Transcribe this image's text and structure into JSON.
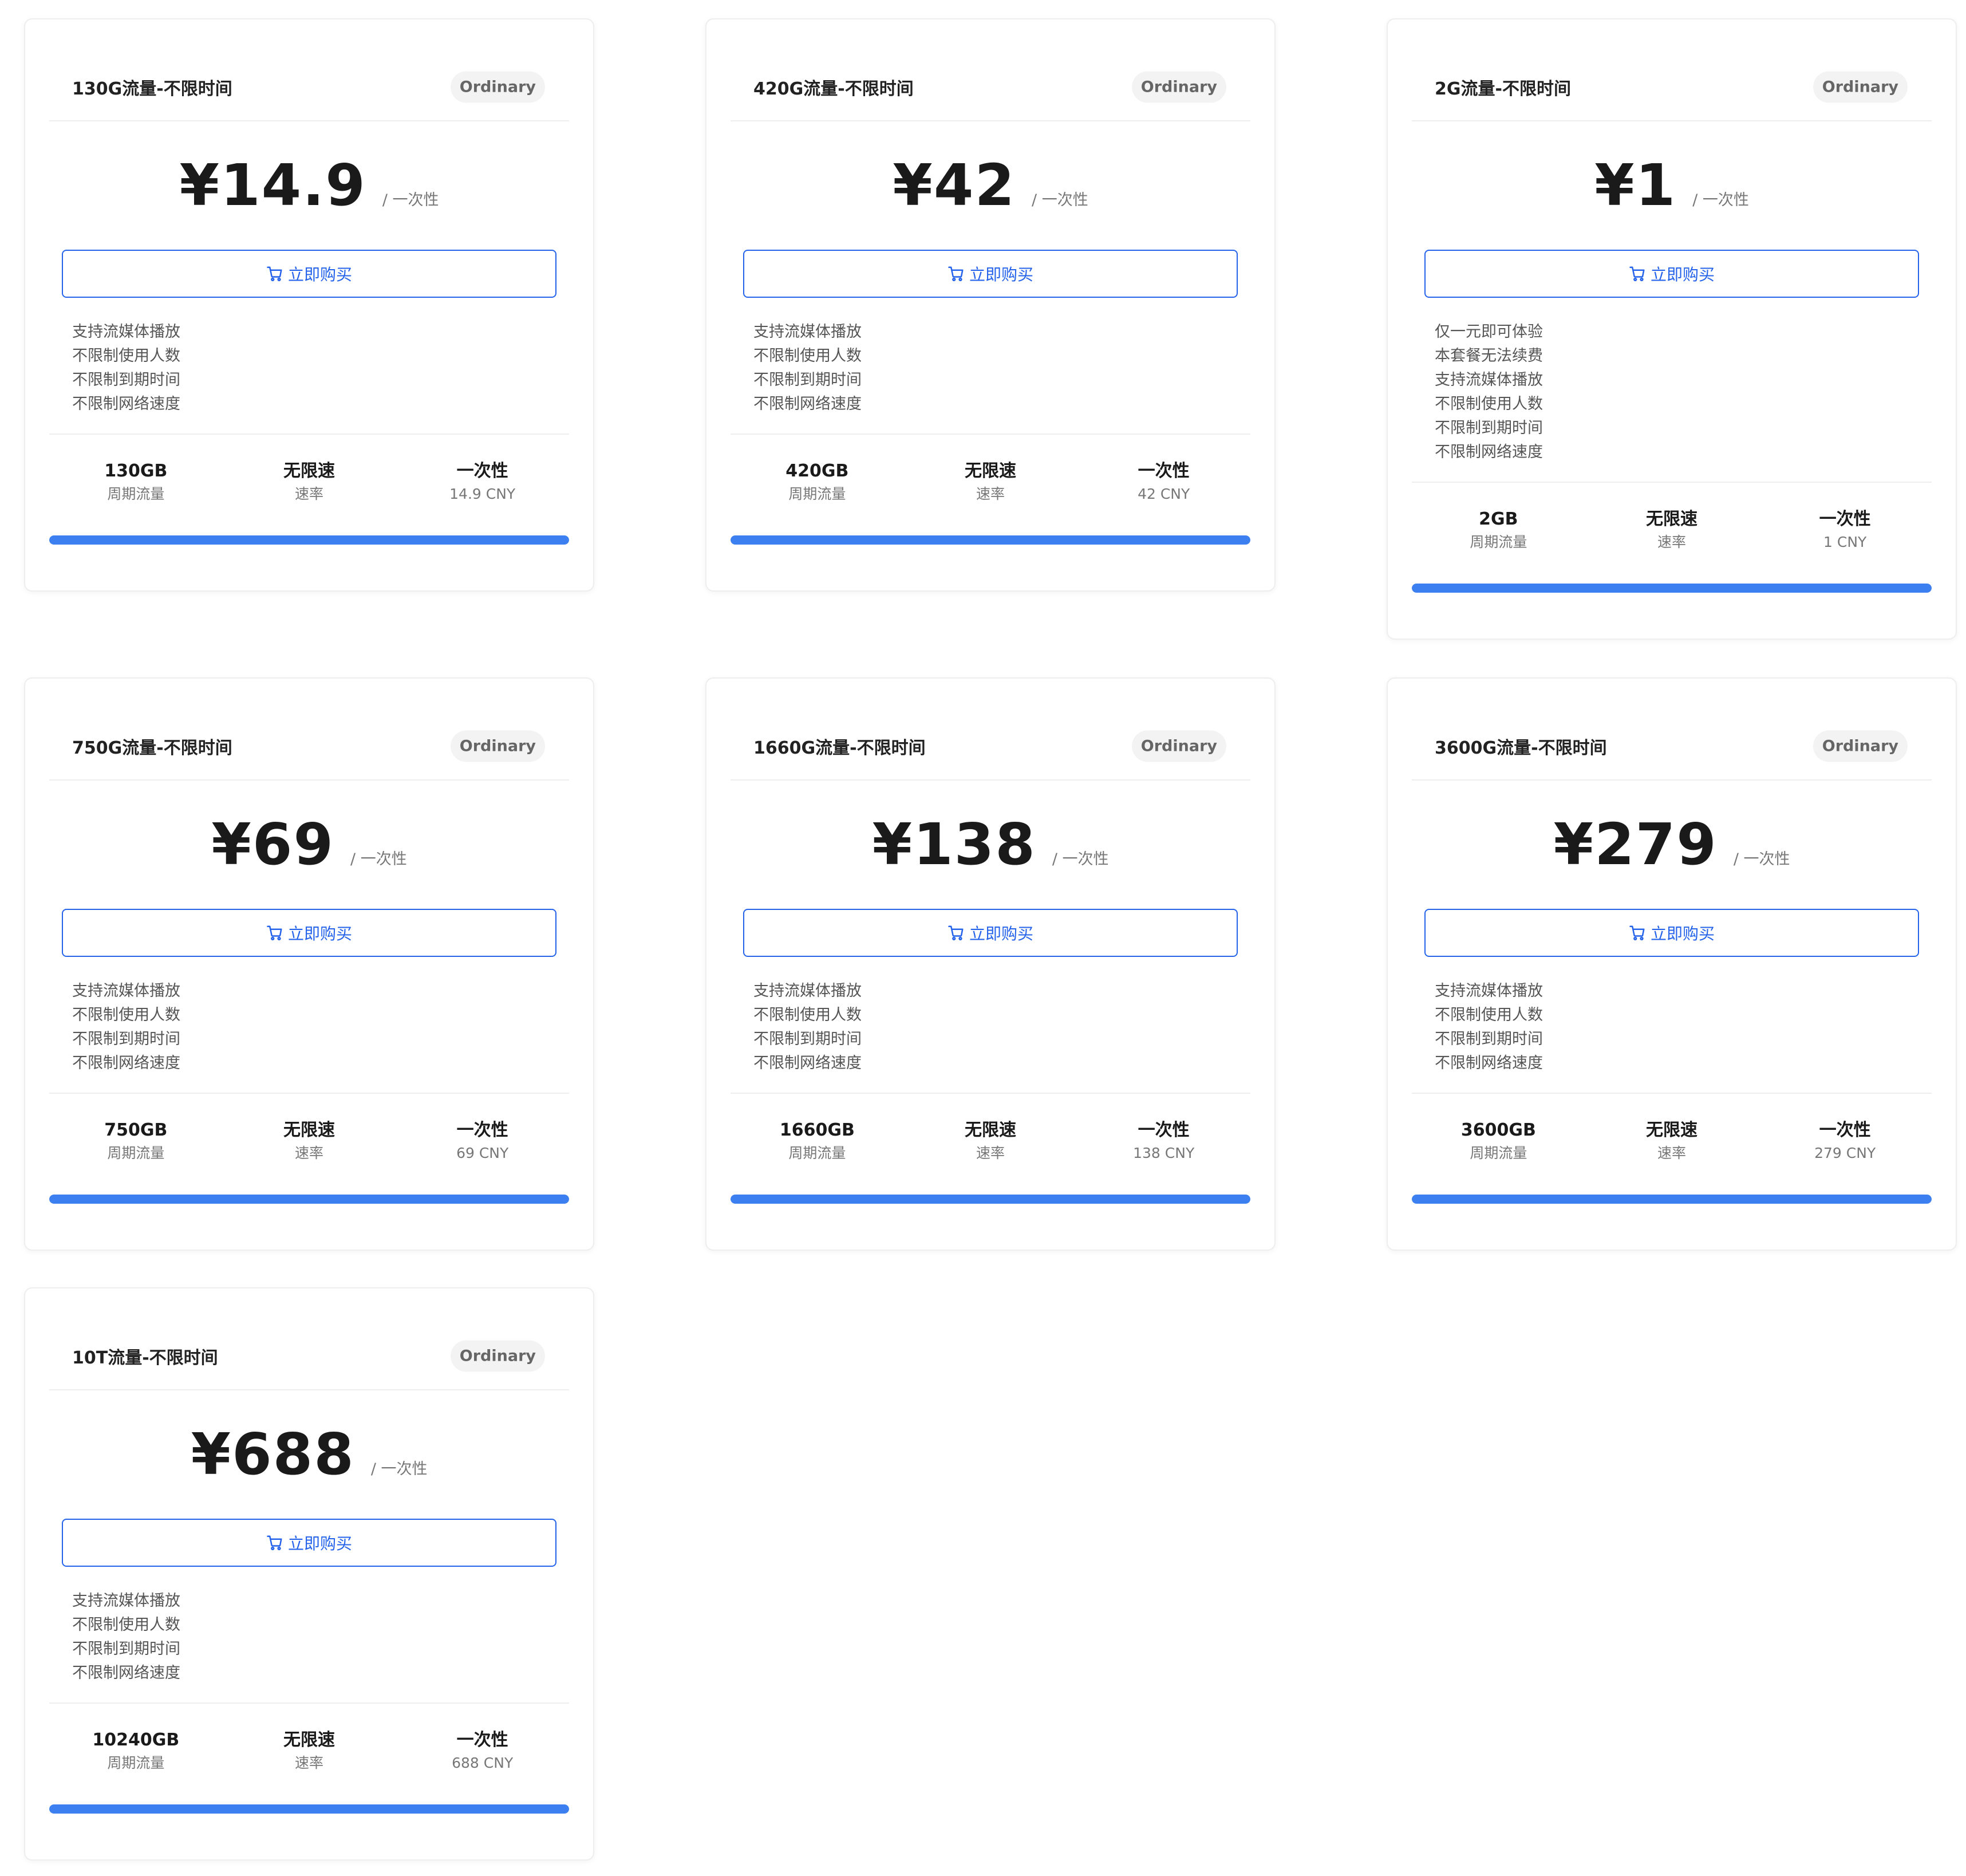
{
  "colors": {
    "accent": "#2563eb",
    "progress": "#3b7ff0",
    "badge_bg": "#f3f3f3"
  },
  "plans": [
    {
      "title": "130G流量-不限时间",
      "badge": "Ordinary",
      "price": "¥14.9",
      "period": "/ 一次性",
      "buy_label": "立即购买",
      "features": [
        "支持流媒体播放",
        "不限制使用人数",
        "不限制到期时间",
        "不限制网络速度"
      ],
      "stats": [
        {
          "value": "130GB",
          "label": "周期流量"
        },
        {
          "value": "无限速",
          "label": "速率"
        },
        {
          "value": "一次性",
          "label": "14.9 CNY"
        }
      ],
      "progress": 1.0
    },
    {
      "title": "420G流量-不限时间",
      "badge": "Ordinary",
      "price": "¥42",
      "period": "/ 一次性",
      "buy_label": "立即购买",
      "features": [
        "支持流媒体播放",
        "不限制使用人数",
        "不限制到期时间",
        "不限制网络速度"
      ],
      "stats": [
        {
          "value": "420GB",
          "label": "周期流量"
        },
        {
          "value": "无限速",
          "label": "速率"
        },
        {
          "value": "一次性",
          "label": "42 CNY"
        }
      ],
      "progress": 1.0
    },
    {
      "title": "2G流量-不限时间",
      "badge": "Ordinary",
      "price": "¥1",
      "period": "/ 一次性",
      "buy_label": "立即购买",
      "features": [
        "仅一元即可体验",
        "本套餐无法续费",
        "支持流媒体播放",
        "不限制使用人数",
        "不限制到期时间",
        "不限制网络速度"
      ],
      "stats": [
        {
          "value": "2GB",
          "label": "周期流量"
        },
        {
          "value": "无限速",
          "label": "速率"
        },
        {
          "value": "一次性",
          "label": "1 CNY"
        }
      ],
      "progress": 1.0
    },
    {
      "title": "750G流量-不限时间",
      "badge": "Ordinary",
      "price": "¥69",
      "period": "/ 一次性",
      "buy_label": "立即购买",
      "features": [
        "支持流媒体播放",
        "不限制使用人数",
        "不限制到期时间",
        "不限制网络速度"
      ],
      "stats": [
        {
          "value": "750GB",
          "label": "周期流量"
        },
        {
          "value": "无限速",
          "label": "速率"
        },
        {
          "value": "一次性",
          "label": "69 CNY"
        }
      ],
      "progress": 1.0
    },
    {
      "title": "1660G流量-不限时间",
      "badge": "Ordinary",
      "price": "¥138",
      "period": "/ 一次性",
      "buy_label": "立即购买",
      "features": [
        "支持流媒体播放",
        "不限制使用人数",
        "不限制到期时间",
        "不限制网络速度"
      ],
      "stats": [
        {
          "value": "1660GB",
          "label": "周期流量"
        },
        {
          "value": "无限速",
          "label": "速率"
        },
        {
          "value": "一次性",
          "label": "138 CNY"
        }
      ],
      "progress": 1.0
    },
    {
      "title": "3600G流量-不限时间",
      "badge": "Ordinary",
      "price": "¥279",
      "period": "/ 一次性",
      "buy_label": "立即购买",
      "features": [
        "支持流媒体播放",
        "不限制使用人数",
        "不限制到期时间",
        "不限制网络速度"
      ],
      "stats": [
        {
          "value": "3600GB",
          "label": "周期流量"
        },
        {
          "value": "无限速",
          "label": "速率"
        },
        {
          "value": "一次性",
          "label": "279 CNY"
        }
      ],
      "progress": 1.0
    },
    {
      "title": "10T流量-不限时间",
      "badge": "Ordinary",
      "price": "¥688",
      "period": "/ 一次性",
      "buy_label": "立即购买",
      "features": [
        "支持流媒体播放",
        "不限制使用人数",
        "不限制到期时间",
        "不限制网络速度"
      ],
      "stats": [
        {
          "value": "10240GB",
          "label": "周期流量"
        },
        {
          "value": "无限速",
          "label": "速率"
        },
        {
          "value": "一次性",
          "label": "688 CNY"
        }
      ],
      "progress": 1.0
    }
  ]
}
